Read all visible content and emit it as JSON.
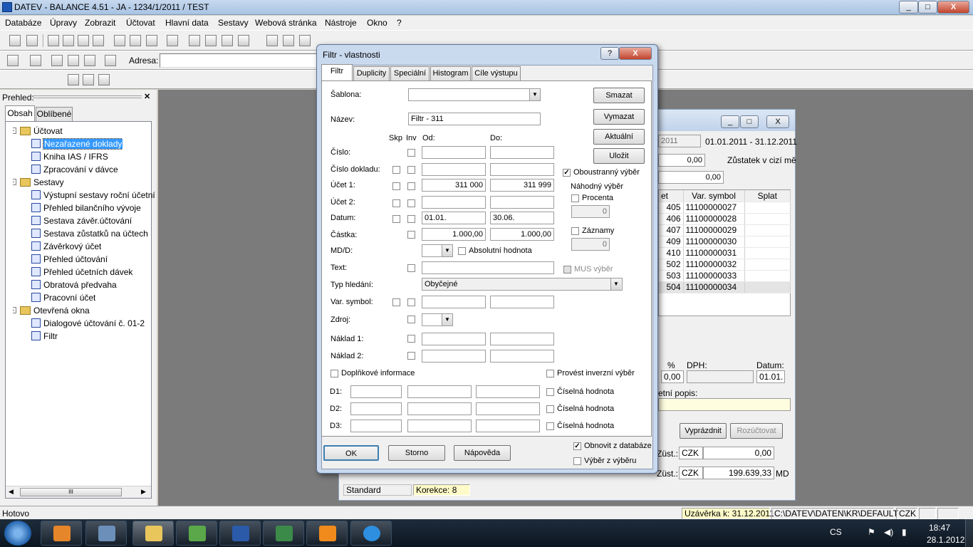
{
  "window": {
    "title": "DATEV - BALANCE 4.51 - JA - 1234/1/2011 / TEST",
    "btn_min": "_",
    "btn_max": "□",
    "btn_close": "X"
  },
  "menu": [
    "Databáze",
    "Úpravy",
    "Zobrazit",
    "Účtovat",
    "Hlavní data",
    "Sestavy",
    "Webová stránka",
    "Nástroje",
    "Okno",
    "?"
  ],
  "address": {
    "label": "Adresa:",
    "value": ""
  },
  "sidebar": {
    "title": "Prehled:",
    "tabs": [
      "Obsah",
      "Oblíbené"
    ],
    "tree": [
      {
        "label": "Účtovat",
        "type": "folder",
        "indent": 0
      },
      {
        "label": "Nezařazené doklady",
        "type": "item",
        "indent": 1,
        "selected": true
      },
      {
        "label": "Kniha IAS / IFRS",
        "type": "item",
        "indent": 1
      },
      {
        "label": "Zpracování v dávce",
        "type": "item",
        "indent": 1
      },
      {
        "label": "Sestavy",
        "type": "folder",
        "indent": 0
      },
      {
        "label": "Výstupní sestavy roční účetní",
        "type": "item",
        "indent": 1
      },
      {
        "label": "Přehled bilančního vývoje",
        "type": "item",
        "indent": 1
      },
      {
        "label": "Sestava závěr.účtování",
        "type": "item",
        "indent": 1
      },
      {
        "label": "Sestava zůstatků na účtech",
        "type": "item",
        "indent": 1
      },
      {
        "label": "Závěrkový účet",
        "type": "item",
        "indent": 1
      },
      {
        "label": "Přehled účtování",
        "type": "item",
        "indent": 1
      },
      {
        "label": "Přehled účetních dávek",
        "type": "item",
        "indent": 1
      },
      {
        "label": "Obratová předvaha",
        "type": "item",
        "indent": 1
      },
      {
        "label": "Pracovní účet",
        "type": "item",
        "indent": 1
      },
      {
        "label": "Otevřená okna",
        "type": "folder",
        "indent": 0
      },
      {
        "label": "Dialogové účtování č. 01-2",
        "type": "doc",
        "indent": 1
      },
      {
        "label": "Filtr",
        "type": "doc",
        "indent": 1
      }
    ],
    "scroll_mid": "III"
  },
  "bgwin": {
    "period_year": "2011",
    "period_range": "01.01.2011 - 31.12.2011",
    "val1": "0,00",
    "zustatek_label": "Zůstatek v cizí mě",
    "val2": "0,00",
    "col_et": "et",
    "col_var": "Var. symbol",
    "col_splat": "Splat",
    "rows": [
      [
        "405",
        "11100000027"
      ],
      [
        "406",
        "11100000028"
      ],
      [
        "407",
        "11100000029"
      ],
      [
        "409",
        "11100000030"
      ],
      [
        "410",
        "11100000031"
      ],
      [
        "502",
        "11100000032"
      ],
      [
        "503",
        "11100000033"
      ],
      [
        "504",
        "11100000034"
      ]
    ],
    "pct_label": "%",
    "dph_label": "DPH:",
    "datum_label": "Datum:",
    "pct_value": "0,00",
    "datum_value": "01.01.",
    "popis_label": "etní popis:",
    "vyprazdnit": "Vyprázdnit",
    "rozuctovat": "Rozúčtovat",
    "zust_label1": "Züst.:",
    "czk1": "CZK",
    "amount1": "0,00",
    "zust_label2": "Züst.:",
    "czk2": "CZK",
    "amount2": "199.639,33",
    "md": "MD",
    "status_standard": "Standard",
    "status_korekce": "Korekce: 8"
  },
  "dialog": {
    "title": "Filtr - vlastnosti",
    "help": "?",
    "close": "X",
    "tabs": [
      "Filtr",
      "Duplicity",
      "Speciální",
      "Histogram",
      "Cíle výstupu"
    ],
    "sablona_label": "Šablona:",
    "sablona_value": "",
    "nazev_label": "Název:",
    "nazev_value": "Filtr - 311",
    "hdr_skp": "Skp",
    "hdr_inv": "Inv",
    "hdr_od": "Od:",
    "hdr_do": "Do:",
    "cislo_label": "Číslo:",
    "cislo_dokladu_label": "Číslo dokladu:",
    "ucet1_label": "Účet 1:",
    "ucet1_od": "311 000",
    "ucet1_do": "311 999",
    "ucet2_label": "Účet 2:",
    "datum_label": "Datum:",
    "datum_od": "01.01.",
    "datum_do": "30.06.",
    "castka_label": "Částka:",
    "castka_od": "1.000,00",
    "castka_do": "1.000,00",
    "mdd_label": "MD/D:",
    "absolutni": "Absolutní hodnota",
    "text_label": "Text:",
    "typ_label": "Typ hledání:",
    "typ_value": "Obyčejné",
    "var_label": "Var. symbol:",
    "zdroj_label": "Zdroj:",
    "naklad1_label": "Náklad 1:",
    "naklad2_label": "Náklad 2:",
    "doplnkove": "Doplňkové informace",
    "inverzni": "Provést inverzní výběr",
    "d1_label": "D1:",
    "d2_label": "D2:",
    "d3_label": "D3:",
    "ciselna": "Číselná hodnota",
    "btn_smazat": "Smazat",
    "btn_vymazat": "Vymazat",
    "btn_aktualni": "Aktuální",
    "btn_ulozit": "Uložit",
    "oboustranny": "Oboustranný výběr",
    "nahodny": "Náhodný výběr",
    "procenta": "Procenta",
    "procenta_value": "0",
    "zaznamy": "Záznamy",
    "zaznamy_value": "0",
    "mus": "MUS výběr",
    "btn_ok": "OK",
    "btn_storno": "Storno",
    "btn_napoveda": "Nápověda",
    "obnovit": "Obnovit z databáze",
    "vyber_z_vyberu": "Výběr z výběru"
  },
  "statusbar": {
    "hotovo": "Hotovo",
    "uzaverka": "Uzávěrka k: 31.12.2011",
    "path": "C:\\DATEV\\DATEN\\KR\\DEFAULT",
    "currency": "CZK"
  },
  "taskbar": {
    "lang": "CS",
    "time": "18:47",
    "date": "28.1.2012"
  }
}
